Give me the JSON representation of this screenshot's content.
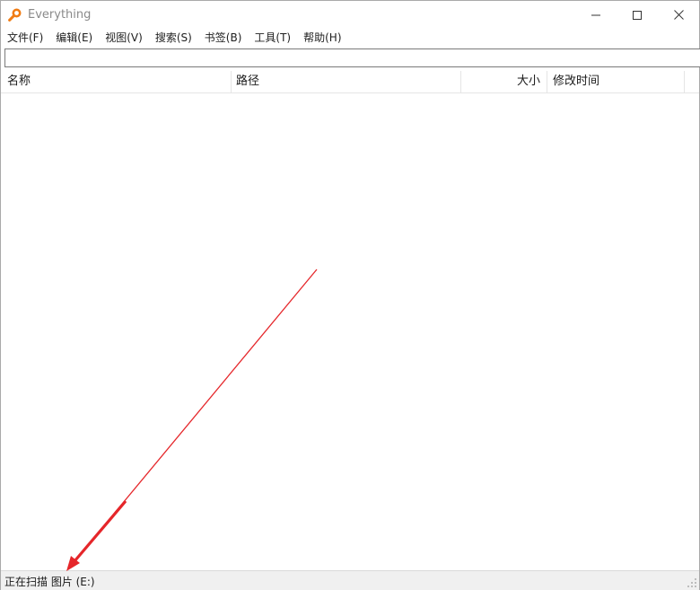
{
  "window": {
    "title": "Everything"
  },
  "menu": {
    "items": [
      {
        "label": "文件(F)"
      },
      {
        "label": "编辑(E)"
      },
      {
        "label": "视图(V)"
      },
      {
        "label": "搜索(S)"
      },
      {
        "label": "书签(B)"
      },
      {
        "label": "工具(T)"
      },
      {
        "label": "帮助(H)"
      }
    ]
  },
  "search": {
    "value": "",
    "placeholder": ""
  },
  "columns": [
    {
      "label": "名称"
    },
    {
      "label": "路径"
    },
    {
      "label": "大小"
    },
    {
      "label": "修改时间"
    }
  ],
  "status": {
    "text": "正在扫描 图片 (E:)"
  },
  "icons": {
    "app": "everything-magnifier-icon",
    "minimize": "minimize-icon",
    "maximize": "maximize-icon",
    "close": "close-icon",
    "resize": "resize-grip-icon",
    "annotation": "red-arrow-annotation"
  },
  "colors": {
    "app_icon": "#f07c14",
    "annotation_arrow": "#e5262a",
    "title_text": "#8a8a8a",
    "statusbar_bg": "#f0f0f0"
  }
}
